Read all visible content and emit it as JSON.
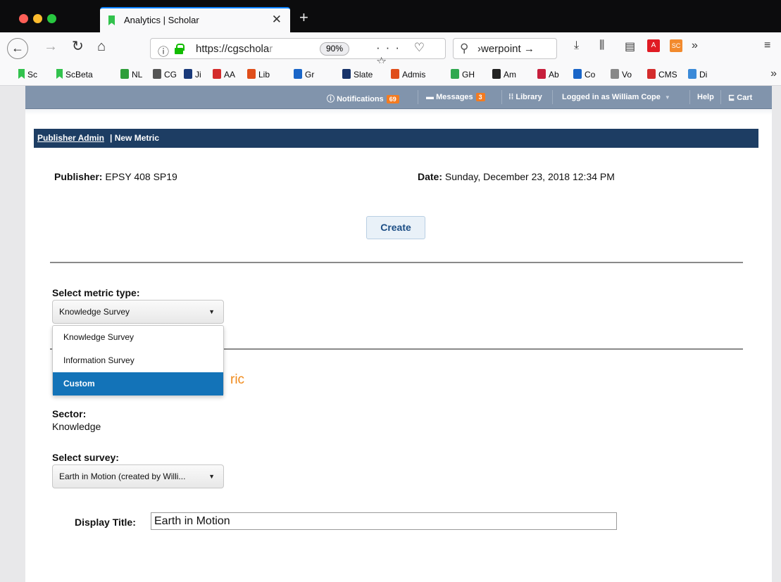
{
  "browser": {
    "tab_title": "Analytics | Scholar",
    "url_host": "https://cgschola",
    "url_rest": "r",
    "zoom": "90%",
    "search_text": "›werpoint →",
    "bookmarks": [
      {
        "label": "Sc",
        "color": "#32c24d"
      },
      {
        "label": "ScBeta",
        "color": "#32c24d"
      },
      {
        "label": "NL",
        "color": "#2e9e3a"
      },
      {
        "label": "CG",
        "color": "#555555"
      },
      {
        "label": "Ji",
        "color": "#1a3a7a"
      },
      {
        "label": "AA",
        "color": "#d42c2c"
      },
      {
        "label": "Lib",
        "color": "#e04e1a"
      },
      {
        "label": "Gr",
        "color": "#1a66c8"
      },
      {
        "label": "Slate",
        "color": "#17336a"
      },
      {
        "label": "Admis",
        "color": "#e04e1a"
      },
      {
        "label": "GH",
        "color": "#2fa84f"
      },
      {
        "label": "Am",
        "color": "#222222"
      },
      {
        "label": "Ab",
        "color": "#c71f3c"
      },
      {
        "label": "Co",
        "color": "#1a66c8"
      },
      {
        "label": "Vo",
        "color": "#888888"
      },
      {
        "label": "CMS",
        "color": "#d42c2c"
      },
      {
        "label": "Di",
        "color": "#3b8ad8"
      }
    ]
  },
  "topnav": {
    "notifications_label": "Notifications",
    "notifications_count": "69",
    "messages_label": "Messages",
    "messages_count": "3",
    "library_label": "Library",
    "user_label": "Logged in as William Cope",
    "help_label": "Help",
    "cart_label": "Cart"
  },
  "page": {
    "breadcrumb_link": "Publisher Admin",
    "breadcrumb_rest": "|  New Metric",
    "publisher_label": "Publisher:",
    "publisher_value": "EPSY 408 SP19",
    "date_label": "Date:",
    "date_value": "Sunday, December 23, 2018 12:34 PM",
    "create_button": "Create",
    "metric_type_label": "Select metric type:",
    "metric_type_selected": "Knowledge Survey",
    "metric_type_options": [
      "Knowledge Survey",
      "Information Survey",
      "Custom"
    ],
    "hidden_title_tail": "ric",
    "sector_label": "Sector:",
    "sector_value": "Knowledge",
    "survey_label": "Select survey:",
    "survey_selected": "Earth in Motion (created by Willi...",
    "display_title_label": "Display Title:",
    "display_title_value": "Earth in Motion"
  }
}
